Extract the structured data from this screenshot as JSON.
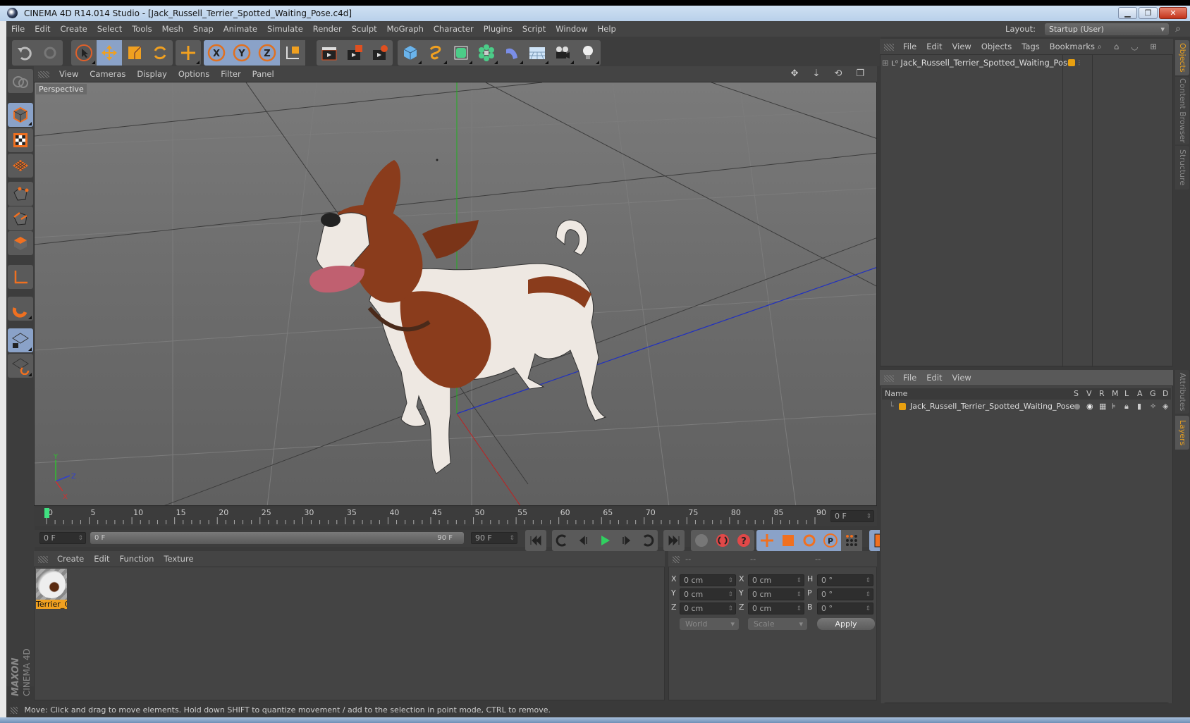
{
  "window": {
    "title": "CINEMA 4D R14.014 Studio - [Jack_Russell_Terrier_Spotted_Waiting_Pose.c4d]",
    "minimize": "▁",
    "restore": "❐",
    "close": "✕"
  },
  "menubar": {
    "items": [
      "File",
      "Edit",
      "Create",
      "Select",
      "Tools",
      "Mesh",
      "Snap",
      "Animate",
      "Simulate",
      "Render",
      "Sculpt",
      "MoGraph",
      "Character",
      "Plugins",
      "Script",
      "Window",
      "Help"
    ],
    "layout_label": "Layout:",
    "layout_value": "Startup (User)"
  },
  "toolbar": {
    "icons": [
      "undo-icon",
      "redo-icon",
      "live-selection-icon",
      "move-icon",
      "scale-icon",
      "rotate-icon",
      "create-tool-icon",
      "x-axis-lock-icon",
      "y-axis-lock-icon",
      "z-axis-lock-icon",
      "coordinate-system-icon",
      "render-view-icon",
      "render-picture-viewer-icon",
      "render-settings-icon",
      "cube-primitive-icon",
      "spline-pen-icon",
      "nurbs-icon",
      "mograph-cloner-icon",
      "deformer-bend-icon",
      "floor-scene-icon",
      "camera-icon",
      "light-icon"
    ]
  },
  "left_toolbar": {
    "icons": [
      "make-editable-icon",
      "model-mode-icon",
      "texture-mode-icon",
      "workplane-mode-icon",
      "points-mode-icon",
      "edges-mode-icon",
      "polygons-mode-icon",
      "axis-mode-icon",
      "magnet-tweak-icon",
      "workplane-lock-icon",
      "workplane-snap-icon"
    ]
  },
  "viewport": {
    "menu": [
      "View",
      "Cameras",
      "Display",
      "Options",
      "Filter",
      "Panel"
    ],
    "camera_label": "Perspective",
    "axis_labels": {
      "x": "X",
      "y": "Y",
      "z": "Z"
    }
  },
  "timeline": {
    "ticks": [
      "0",
      "5",
      "10",
      "15",
      "20",
      "25",
      "30",
      "35",
      "40",
      "45",
      "50",
      "55",
      "60",
      "65",
      "70",
      "75",
      "80",
      "85",
      "90"
    ],
    "current_frame": "0 F",
    "start_field": "0 F",
    "range_start": "0 F",
    "range_end": "90 F",
    "end_field": "90 F",
    "progress_fraction": 0
  },
  "material_manager": {
    "menu": [
      "Create",
      "Edit",
      "Function",
      "Texture"
    ],
    "materials": [
      {
        "name": "Terrier_C",
        "selected": true
      }
    ]
  },
  "coordinates": {
    "headers": [
      "--",
      "--",
      "--"
    ],
    "rows": [
      {
        "pos_label": "X",
        "pos": "0 cm",
        "size_label": "X",
        "size": "0 cm",
        "rot_label": "H",
        "rot": "0 °"
      },
      {
        "pos_label": "Y",
        "pos": "0 cm",
        "size_label": "Y",
        "size": "0 cm",
        "rot_label": "P",
        "rot": "0 °"
      },
      {
        "pos_label": "Z",
        "pos": "0 cm",
        "size_label": "Z",
        "size": "0 cm",
        "rot_label": "B",
        "rot": "0 °"
      }
    ],
    "space_select": "World",
    "mode_select": "Scale",
    "apply_label": "Apply"
  },
  "object_manager": {
    "menu": [
      "File",
      "Edit",
      "View",
      "Objects",
      "Tags",
      "Bookmarks"
    ],
    "objects": [
      {
        "name": "Jack_Russell_Terrier_Spotted_Waiting_Pose",
        "layer_color": "#e8a010"
      }
    ]
  },
  "layer_manager": {
    "menu": [
      "File",
      "Edit",
      "View"
    ],
    "columns": [
      "Name",
      "S",
      "V",
      "R",
      "M",
      "L",
      "A",
      "G",
      "D"
    ],
    "layers": [
      {
        "name": "Jack_Russell_Terrier_Spotted_Waiting_Pose",
        "color": "#e8a010"
      }
    ]
  },
  "right_tabs": {
    "top": [
      {
        "label": "Objects",
        "active": true
      },
      {
        "label": "Content Browser",
        "active": false
      },
      {
        "label": "Structure",
        "active": false
      }
    ],
    "bottom": [
      {
        "label": "Attributes",
        "active": false
      },
      {
        "label": "Layers",
        "active": true
      }
    ]
  },
  "statusbar": {
    "text": "Move: Click and drag to move elements. Hold down SHIFT to quantize movement / add to the selection in point mode, CTRL to remove."
  },
  "branding": {
    "maxon": "MAXON",
    "product": "CINEMA 4D"
  },
  "colors": {
    "accent_orange": "#e8a010",
    "selected_blue": "#8aa2c8",
    "x_axis": "#d03030",
    "y_axis": "#30c030",
    "z_axis": "#3040d0"
  }
}
